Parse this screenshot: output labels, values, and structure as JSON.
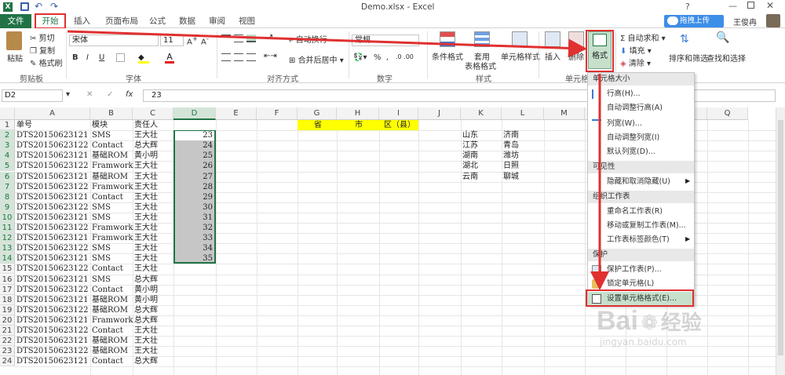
{
  "title": {
    "file": "Demo.xlsx - Excel",
    "upload_label": "拖拽上传",
    "user": "王俊冉"
  },
  "tabs": [
    "文件",
    "开始",
    "插入",
    "页面布局",
    "公式",
    "数据",
    "审阅",
    "视图"
  ],
  "ribbon": {
    "paste": "粘贴",
    "cut": "剪切",
    "copy": "复制",
    "format_painter": "格式刷",
    "clipboard": "剪贴板",
    "font_name": "宋体",
    "font_size": "11",
    "font_group": "字体",
    "wrap": "自动换行",
    "merge": "合并后居中",
    "align_group": "对齐方式",
    "number_format": "常规",
    "number_group": "数字",
    "cond_format": "条件格式",
    "table_format_1": "套用",
    "table_format_2": "表格格式",
    "cell_style": "单元格样式",
    "style_group": "样式",
    "insert": "插入",
    "delete": "删除",
    "format": "格式",
    "cells_group": "单元格",
    "autosum": "自动求和",
    "fill": "填充",
    "clear": "清除",
    "sort": "排序和筛选",
    "find": "查找和选择"
  },
  "formula_bar": {
    "name_box": "D2",
    "fx": "fx",
    "value": "23"
  },
  "columns": [
    "A",
    "B",
    "C",
    "D",
    "E",
    "F",
    "G",
    "H",
    "I",
    "J",
    "K",
    "L",
    "M",
    "N",
    "O",
    "P",
    "Q"
  ],
  "rows": [
    [
      "单号",
      "模块",
      "责任人",
      ""
    ],
    [
      "DTS20150623121",
      "SMS",
      "王大壮",
      "23"
    ],
    [
      "DTS20150623122",
      "Contact",
      "总大辉",
      "24"
    ],
    [
      "DTS20150623121",
      "基础ROM",
      "黄小明",
      "25"
    ],
    [
      "DTS20150623122",
      "Framwork",
      "王大壮",
      "26"
    ],
    [
      "DTS20150623121",
      "基础ROM",
      "王大壮",
      "27"
    ],
    [
      "DTS20150623122",
      "Framwork",
      "王大壮",
      "28"
    ],
    [
      "DTS20150623121",
      "Contact",
      "王大壮",
      "29"
    ],
    [
      "DTS20150623122",
      "SMS",
      "王大壮",
      "30"
    ],
    [
      "DTS20150623121",
      "SMS",
      "王大壮",
      "31"
    ],
    [
      "DTS20150623122",
      "Framwork",
      "王大壮",
      "32"
    ],
    [
      "DTS20150623121",
      "Framwork",
      "王大壮",
      "33"
    ],
    [
      "DTS20150623122",
      "SMS",
      "王大壮",
      "34"
    ],
    [
      "DTS20150623121",
      "SMS",
      "王大壮",
      "35"
    ],
    [
      "DTS20150623122",
      "Contact",
      "王大壮",
      ""
    ],
    [
      "DTS20150623121",
      "SMS",
      "总大辉",
      ""
    ],
    [
      "DTS20150623122",
      "Contact",
      "黄小明",
      ""
    ],
    [
      "DTS20150623121",
      "基础ROM",
      "黄小明",
      ""
    ],
    [
      "DTS20150623122",
      "基础ROM",
      "总大辉",
      ""
    ],
    [
      "DTS20150623121",
      "Framwork",
      "总大辉",
      ""
    ],
    [
      "DTS20150623122",
      "Contact",
      "王大壮",
      ""
    ],
    [
      "DTS20150623121",
      "基础ROM",
      "王大壮",
      ""
    ],
    [
      "DTS20150623122",
      "基础ROM",
      "王大壮",
      ""
    ],
    [
      "DTS20150623121",
      "Contact",
      "总大辉",
      ""
    ]
  ],
  "yellow_headers": [
    "省",
    "市",
    "区（县）"
  ],
  "cities": [
    [
      "山东",
      "济南"
    ],
    [
      "江苏",
      "青岛"
    ],
    [
      "湖南",
      "潍坊"
    ],
    [
      "湖北",
      "日照"
    ],
    [
      "云南",
      "聊城"
    ]
  ],
  "menu": {
    "h1": "单元格大小",
    "row_height": "行高(H)...",
    "auto_row": "自动调整行高(A)",
    "col_width": "列宽(W)...",
    "auto_col": "自动调整列宽(I)",
    "default_width": "默认列宽(D)...",
    "h2": "可见性",
    "hide": "隐藏和取消隐藏(U)",
    "h3": "组织工作表",
    "rename": "重命名工作表(R)",
    "move_copy": "移动或复制工作表(M)...",
    "tab_color": "工作表标签颜色(T)",
    "h4": "保护",
    "protect": "保护工作表(P)...",
    "lock": "锁定单元格(L)",
    "format_cells": "设置单元格格式(E)..."
  },
  "watermark": {
    "brand": "Bai",
    "brand2": "经验",
    "url": "jingyan.baidu.com"
  },
  "colors": {
    "excel_green": "#217346",
    "red": "#e03030",
    "yellow": "#ffff00",
    "selection": "#c6c6c6"
  }
}
